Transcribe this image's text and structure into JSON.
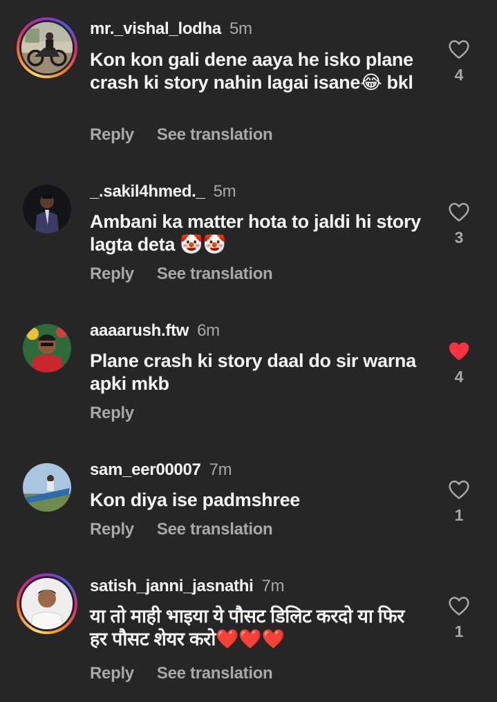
{
  "colors": {
    "background": "#262626",
    "primary_text": "#f5f5f5",
    "secondary_text": "#a8a8a8",
    "liked_heart": "#ff3040"
  },
  "labels": {
    "reply": "Reply",
    "see_translation": "See translation"
  },
  "comments": [
    {
      "username": "mr._vishal_lodha",
      "time": "5m",
      "text": "Kon kon gali dene aaya he isko plane crash ki story nahin lagai isane😂 bkl",
      "likes": "4",
      "liked": false,
      "show_translation": true,
      "has_story_ring": true,
      "avatar_icon": "motorcycle-photo-avatar"
    },
    {
      "username": "_.sakil4hmed._",
      "time": "5m",
      "text": "Ambani ka matter hota to jaldi hi story lagta deta 🤡🤡",
      "likes": "3",
      "liked": false,
      "show_translation": true,
      "has_story_ring": false,
      "avatar_icon": "person-suit-avatar"
    },
    {
      "username": "aaaarush.ftw",
      "time": "6m",
      "text": "Plane crash ki story daal do sir warna apki mkb",
      "likes": "4",
      "liked": true,
      "show_translation": false,
      "has_story_ring": false,
      "avatar_icon": "colorful-person-avatar"
    },
    {
      "username": "sam_eer00007",
      "time": "7m",
      "text": "Kon diya ise padmshree",
      "likes": "1",
      "liked": false,
      "show_translation": true,
      "has_story_ring": false,
      "avatar_icon": "boat-photo-avatar"
    },
    {
      "username": "satish_janni_jasnathi",
      "time": "7m",
      "text": "या तो माही भाइया ये पौसट डिलिट करदो या फिर हर पौसट शेयर करो❤️❤️❤️",
      "likes": "1",
      "liked": false,
      "show_translation": true,
      "has_story_ring": true,
      "avatar_icon": "man-portrait-avatar"
    }
  ]
}
